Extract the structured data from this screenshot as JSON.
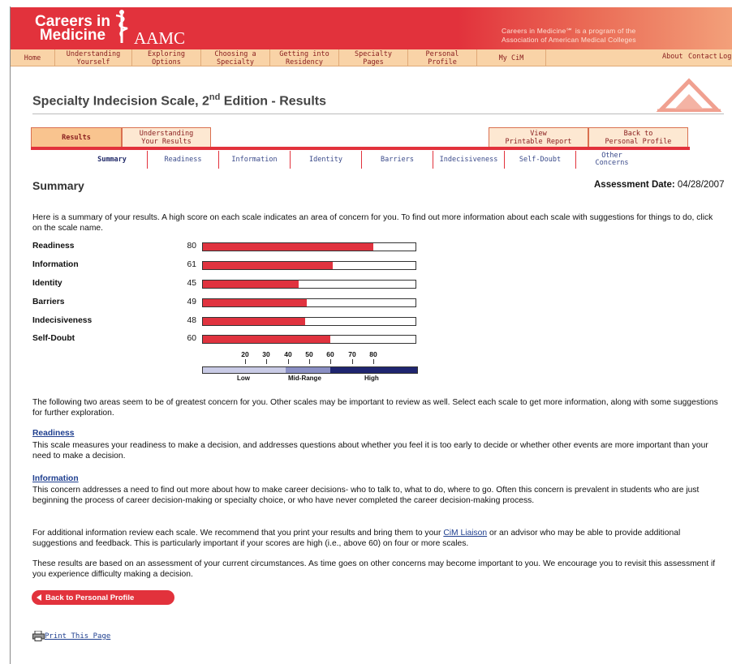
{
  "header": {
    "logo_line1": "Careers in",
    "logo_line2": "Medicine",
    "aamc": "AAMC",
    "tagline_line1": "Careers in Medicine℠ is a program of the",
    "tagline_line2": "Association of American Medical Colleges",
    "brand_color": "#e2323c"
  },
  "nav": {
    "home": "Home",
    "understanding": [
      "Understanding",
      "Yourself"
    ],
    "exploring": [
      "Exploring",
      "Options"
    ],
    "choosing": [
      "Choosing a",
      "Specialty"
    ],
    "getting": [
      "Getting into",
      "Residency"
    ],
    "specialty": [
      "Specialty",
      "Pages"
    ],
    "personal": [
      "Personal",
      "Profile"
    ],
    "mycim": "My CiM",
    "about": "About",
    "contact": "Contact",
    "log": "Log"
  },
  "page": {
    "title_main": "Specialty Indecision Scale, 2",
    "title_sup": "nd",
    "title_rest": " Edition - Results"
  },
  "tabs": {
    "results": "Results",
    "understanding": [
      "Understanding",
      "Your Results"
    ],
    "printable": [
      "View",
      "Printable Report"
    ],
    "back": [
      "Back to",
      "Personal Profile"
    ]
  },
  "subtabs": {
    "summary": "Summary",
    "readiness": "Readiness",
    "information": "Information",
    "identity": "Identity",
    "barriers": "Barriers",
    "indecisiveness": "Indecisiveness",
    "selfdoubt": "Self-Doubt",
    "other": [
      "Other",
      "Concerns"
    ]
  },
  "summary": {
    "heading": "Summary",
    "date_label": "Assessment Date:",
    "date_value": "04/28/2007",
    "intro": "Here is a summary of your results. A high score on each scale indicates an area of concern for you. To find out more information about each scale with suggestions for things to do, click on the scale name."
  },
  "scores": [
    {
      "label": "Readiness",
      "value": 80
    },
    {
      "label": "Information",
      "value": 61
    },
    {
      "label": "Identity",
      "value": 45
    },
    {
      "label": "Barriers",
      "value": 49
    },
    {
      "label": "Indecisiveness",
      "value": 48
    },
    {
      "label": "Self-Doubt",
      "value": 60
    }
  ],
  "scale": {
    "ticks": [
      20,
      30,
      40,
      50,
      60,
      70,
      80
    ],
    "low": "Low",
    "mid": "Mid-Range",
    "high": "High",
    "low_color": "#c9cbe6",
    "mid_color": "#8a8fc4",
    "high_color": "#1f2570"
  },
  "concerns": {
    "intro": "The following two areas seem to be of greatest concern for you. Other scales may be important to review as well. Select each scale to get more information, along with some suggestions for further exploration.",
    "readiness_title": "Readiness",
    "readiness_text": "This scale measures your readiness to make a decision, and addresses questions about whether you feel it is too early to decide or whether other events are more important than your need to make a decision.",
    "information_title": "Information",
    "information_text": "This concern addresses a need to find out more about how to make career decisions- who to talk to, what to do, where to go. Often this concern is prevalent in students who are just beginning the process of career decision-making or specialty choice, or who have never completed the career decision-making process."
  },
  "footer": {
    "additional_pre": "For additional information review each scale. We recommend that you print your results and bring them to your ",
    "liaison_link": "CiM Liaison",
    "additional_post": " or an advisor who may be able to provide additional suggestions and feedback. This is particularly important if your scores are high (i.e., above 60) on four or more scales.",
    "results_note": "These results are based on an assessment of your current circumstances. As time goes on other concerns may become important to you. We encourage you to revisit this assessment if you experience difficulty making a decision.",
    "back_button": "Back to Personal Profile",
    "print_link": "Print This Page"
  }
}
